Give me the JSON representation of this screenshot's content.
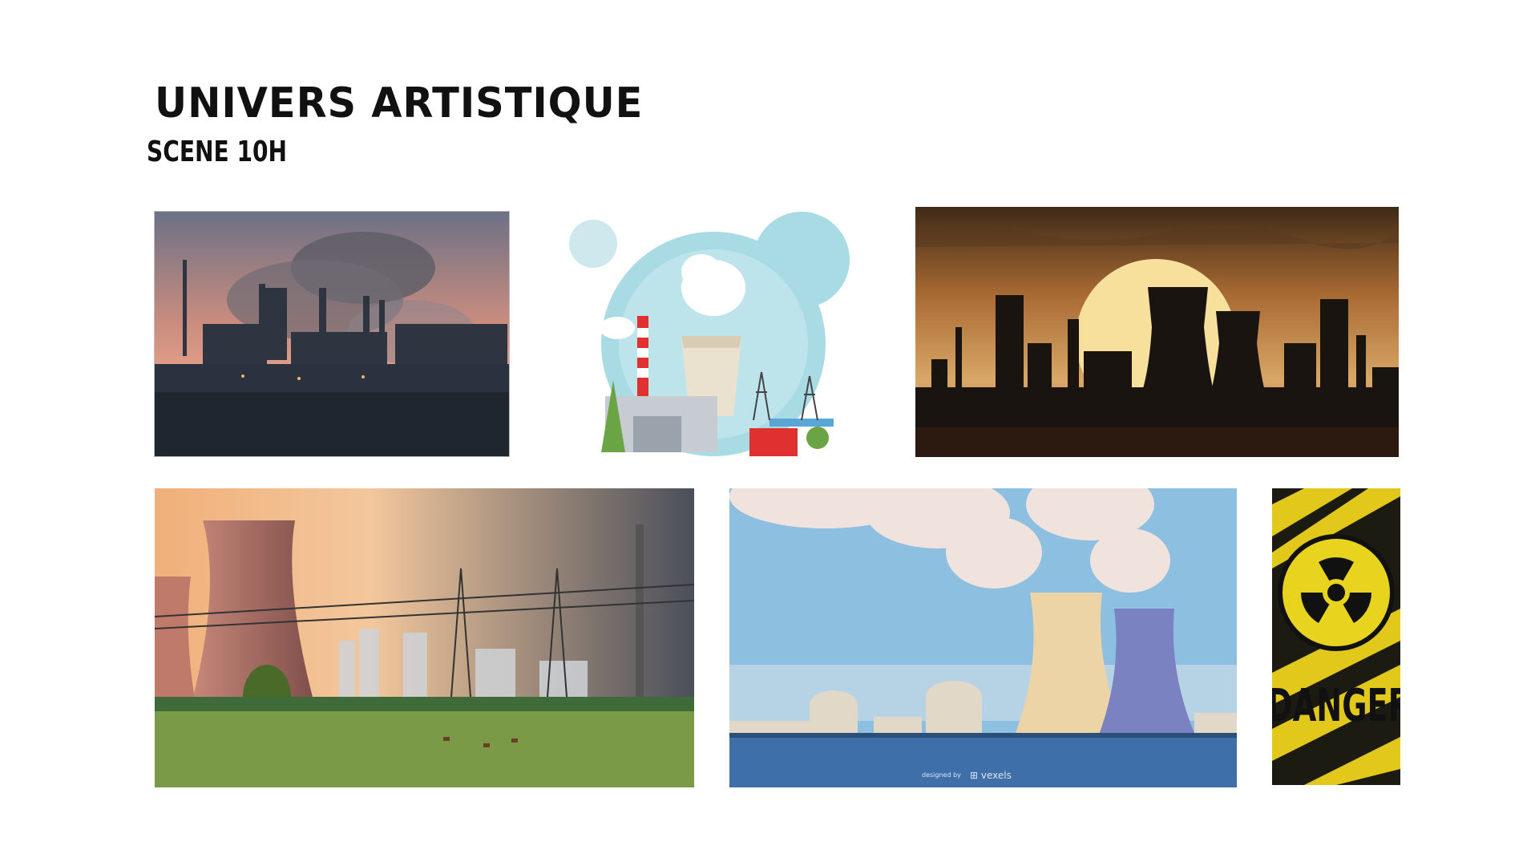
{
  "heading": {
    "title": "UNIVERS ARTISTIQUE",
    "subtitle": "SCENE 10H"
  },
  "gallery": {
    "images": [
      {
        "subject": "smoking-factory-photo"
      },
      {
        "subject": "flat-power-plant-illustration"
      },
      {
        "subject": "cooling-towers-silhouette-sunset"
      },
      {
        "subject": "nuclear-plant-field-photo"
      },
      {
        "subject": "nuclear-plant-by-sea-illustration",
        "watermark": "designed by vexels"
      },
      {
        "subject": "radiation-danger-sign",
        "sign_text": "DANGER"
      }
    ]
  },
  "colors": {
    "background": "#ffffff",
    "heading": "#111111"
  }
}
